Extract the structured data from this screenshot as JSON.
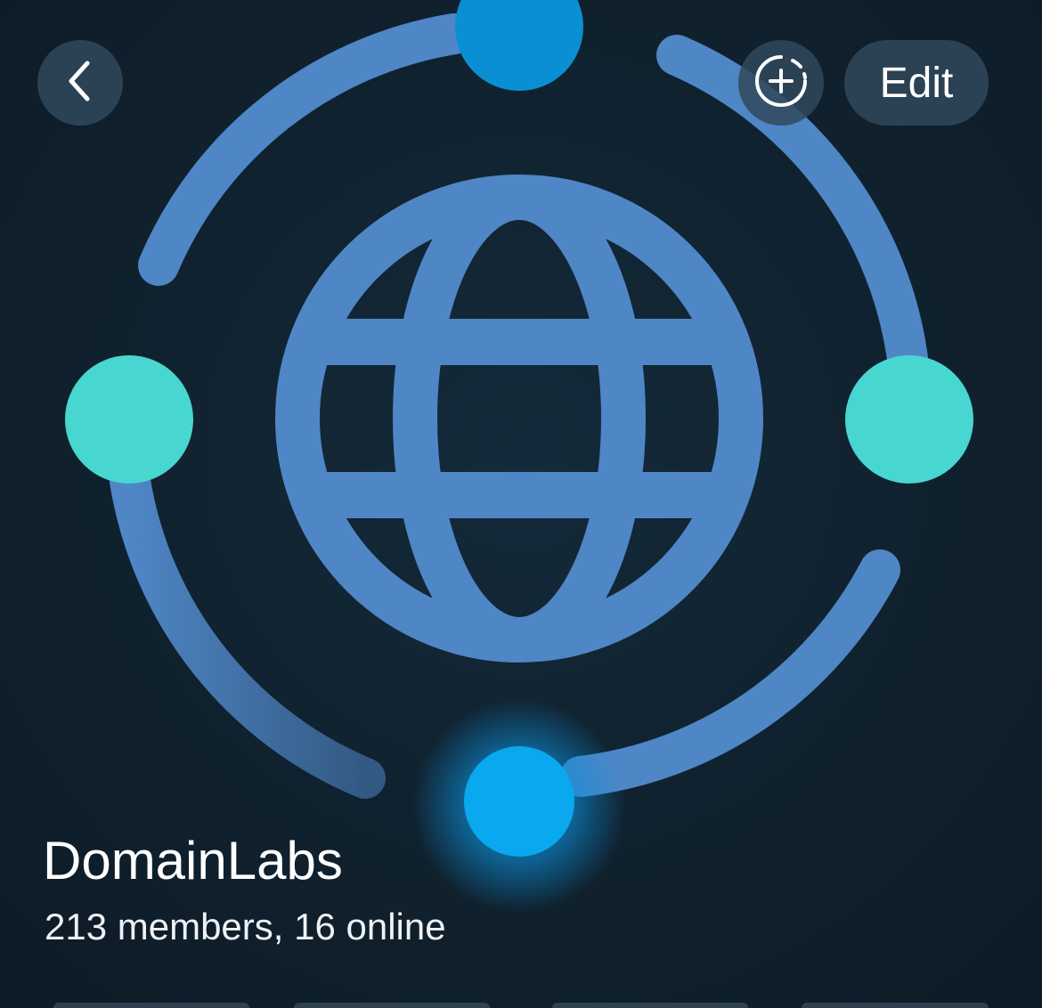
{
  "header": {
    "back_label": "",
    "edit_label": "Edit"
  },
  "icons": {
    "back": "chevron-left-icon",
    "add_story": "add-story-icon",
    "avatar": "globe-network-icon"
  },
  "group": {
    "name": "DomainLabs",
    "status": "213 members, 16 online"
  },
  "colors": {
    "background": "#10202c",
    "globe": "#4f86c6",
    "node_teal": "#48d6d0",
    "node_blue": "#0aa0e6",
    "button_bg": "#30485c",
    "text": "#ffffff"
  }
}
